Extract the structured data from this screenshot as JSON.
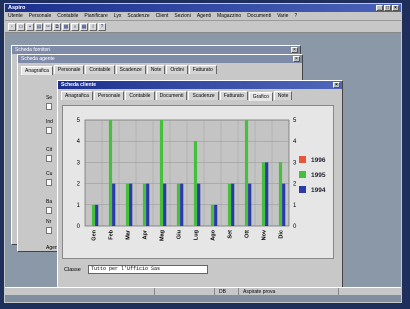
{
  "app": {
    "title": "Aspiro",
    "menu": [
      "Utente",
      "Personale",
      "Contabile",
      "Pianificare",
      "Lyx",
      "Scadenze",
      "Client",
      "Sezioni",
      "Agenti",
      "Magazzino",
      "Documenti",
      "Varie",
      "?"
    ],
    "toolbar_icons": [
      "new-icon",
      "open-icon",
      "save-icon",
      "print-icon",
      "cut-icon",
      "copy-icon",
      "paste-icon",
      "search-icon",
      "calc-icon",
      "info-icon",
      "help-icon"
    ],
    "status": [
      "",
      "",
      "DB",
      "Aspirate prova"
    ]
  },
  "windows": {
    "back1": {
      "title": "Scheda fornitori"
    },
    "back2": {
      "title": "Scheda agente",
      "tabs": [
        "Anagrafica",
        "Personale",
        "Contabile",
        "Scadenze",
        "Note",
        "Ordini",
        "Fatturato"
      ],
      "side_labels": [
        "Se",
        "Ind",
        "Cit",
        "Cu",
        "Ba",
        "Nr",
        "Agent"
      ]
    },
    "front": {
      "title": "Scheda cliente",
      "tabs": [
        "Anagrafica",
        "Personale",
        "Contabile",
        "Documenti",
        "Scadenze",
        "Fatturato",
        "Grafico",
        "Note"
      ],
      "selected_tab": "Grafico",
      "footer_label": "Classe",
      "footer_value": "Tutto per l'Ufficio Sas"
    }
  },
  "chart_data": {
    "type": "bar",
    "categories": [
      "Gen",
      "Feb",
      "Mar",
      "Apr",
      "Mag",
      "Giu",
      "Lug",
      "Ago",
      "Set",
      "Ott",
      "Nov",
      "Dic"
    ],
    "series": [
      {
        "name": "1996",
        "color": "#e8563a",
        "values": [
          0,
          0,
          0,
          0,
          0,
          0,
          0,
          0,
          0,
          0,
          0,
          0
        ]
      },
      {
        "name": "1995",
        "color": "#46c03c",
        "values": [
          1,
          5,
          2,
          2,
          5,
          2,
          4,
          1,
          2,
          5,
          3,
          3
        ]
      },
      {
        "name": "1994",
        "color": "#2c3aa8",
        "values": [
          1,
          2,
          2,
          2,
          2,
          2,
          2,
          1,
          2,
          2,
          3,
          2
        ]
      }
    ],
    "yticks": [
      0,
      1,
      2,
      3,
      4,
      5
    ],
    "ylim": [
      0,
      5
    ],
    "legend": "right",
    "grid": true
  },
  "colors": {
    "accent": "#1c2f8f",
    "chart_bg": "#c4c4c4"
  }
}
